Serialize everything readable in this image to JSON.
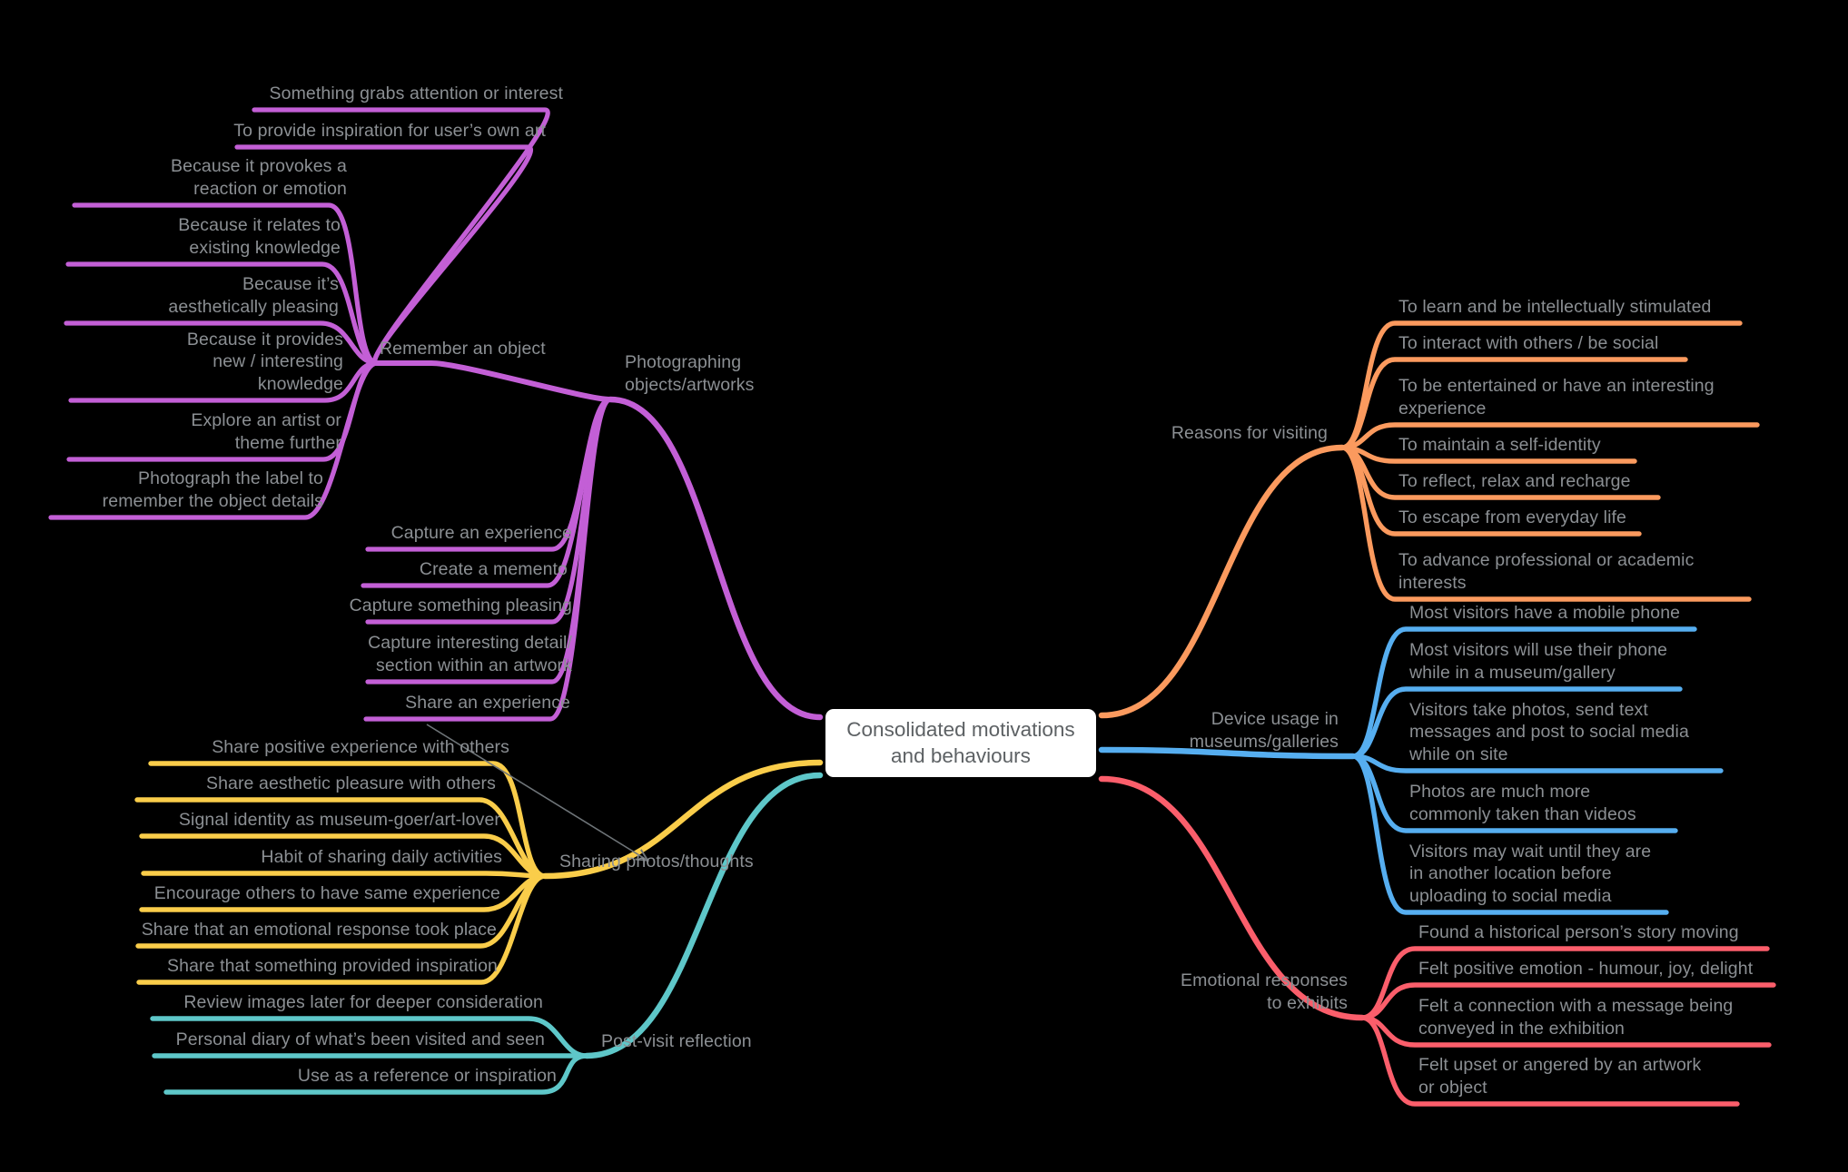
{
  "diagram": {
    "type": "mindmap",
    "background": "#000000",
    "text_color": "#8b8f93",
    "center": {
      "label": "Consolidated motivations\nand behaviours",
      "background": "#ffffff",
      "text_color": "#5d6164"
    },
    "annotation": {
      "name": "cross-link-arrow",
      "from": "Share an experience",
      "to": "Sharing photos/thoughts",
      "color": "#6e7478"
    },
    "branches": [
      {
        "id": "photographing",
        "label": "Photographing\nobjects/artworks",
        "color": "#c35fd6",
        "side": "left",
        "children": [
          {
            "label": "Remember an object",
            "children": [
              {
                "label": "Something grabs attention or interest"
              },
              {
                "label": "To provide inspiration for user’s own art"
              },
              {
                "label": "Because it provokes a\nreaction or emotion"
              },
              {
                "label": "Because it relates to\nexisting knowledge"
              },
              {
                "label": "Because it’s\naesthetically pleasing"
              },
              {
                "label": "Because it provides\nnew / interesting\nknowledge"
              },
              {
                "label": "Explore an artist or\ntheme further"
              },
              {
                "label": "Photograph the label to\nremember the object details"
              }
            ]
          },
          {
            "label": "Capture an experience"
          },
          {
            "label": "Create a memento"
          },
          {
            "label": "Capture something pleasing"
          },
          {
            "label": "Capture interesting detail/\nsection within an artwork"
          },
          {
            "label": "Share an experience"
          }
        ]
      },
      {
        "id": "sharing",
        "label": "Sharing photos/thoughts",
        "color": "#facd4a",
        "side": "left",
        "children": [
          {
            "label": "Share positive experience with others"
          },
          {
            "label": "Share aesthetic pleasure with others"
          },
          {
            "label": "Signal identity as museum-goer/art-lover"
          },
          {
            "label": "Habit of sharing daily activities"
          },
          {
            "label": "Encourage others to have same experience"
          },
          {
            "label": "Share that an emotional response took place"
          },
          {
            "label": "Share that something provided inspiration"
          }
        ]
      },
      {
        "id": "postvisit",
        "label": "Post-visit reflection",
        "color": "#5ec7c9",
        "side": "left",
        "children": [
          {
            "label": "Review images later for deeper consideration"
          },
          {
            "label": "Personal diary of what’s been visited and seen"
          },
          {
            "label": "Use as a reference or inspiration"
          }
        ]
      },
      {
        "id": "reasons",
        "label": "Reasons for visiting",
        "color": "#fb9a5e",
        "side": "right",
        "children": [
          {
            "label": "To learn and be intellectually stimulated"
          },
          {
            "label": "To interact with others / be social"
          },
          {
            "label": "To be entertained or have an interesting\nexperience"
          },
          {
            "label": "To maintain a self-identity"
          },
          {
            "label": "To reflect, relax and recharge"
          },
          {
            "label": "To escape from everyday life"
          },
          {
            "label": "To advance professional or academic\ninterests"
          }
        ]
      },
      {
        "id": "device",
        "label": "Device usage in\nmuseums/galleries",
        "color": "#56aef0",
        "side": "right",
        "children": [
          {
            "label": "Most visitors have a mobile phone"
          },
          {
            "label": "Most visitors will use their phone\nwhile in a museum/gallery"
          },
          {
            "label": "Visitors take photos, send text\nmessages and post to social media\nwhile on site"
          },
          {
            "label": "Photos are much more\ncommonly taken than videos"
          },
          {
            "label": "Visitors may wait until they are\nin another location before\nuploading to social media"
          }
        ]
      },
      {
        "id": "emotional",
        "label": "Emotional responses\nto exhibits",
        "color": "#fb5e6b",
        "side": "right",
        "children": [
          {
            "label": "Found a historical person’s story moving"
          },
          {
            "label": "Felt positive emotion - humour, joy, delight"
          },
          {
            "label": "Felt a connection with a message being\nconveyed in the exhibition"
          },
          {
            "label": "Felt upset or angered by an artwork\nor object"
          }
        ]
      }
    ]
  }
}
